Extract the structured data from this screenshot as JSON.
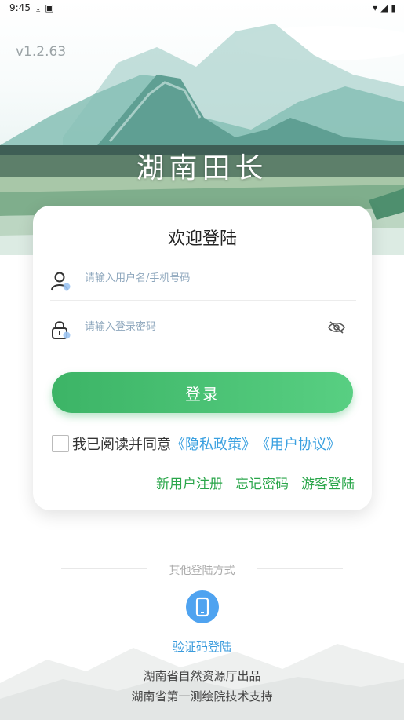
{
  "status": {
    "time": "9:45"
  },
  "version": "v1.2.63",
  "app_title": "湖南田长",
  "card": {
    "title": "欢迎登陆",
    "username_placeholder": "请输入用户名/手机号码",
    "password_placeholder": "请输入登录密码",
    "login_label": "登录",
    "agree_text": "我已阅读并同意",
    "privacy_link": "《隐私政策》",
    "agreement_link": "《用户协议》",
    "register": "新用户注册",
    "forgot": "忘记密码",
    "guest": "游客登陆"
  },
  "other": {
    "label": "其他登陆方式",
    "sms_label": "验证码登陆"
  },
  "footer": {
    "line1": "湖南省自然资源厅出品",
    "line2": "湖南省第一测绘院技术支持"
  },
  "colors": {
    "primary_green": "#3cb466",
    "link_blue": "#3aa0e0",
    "text_green": "#2aa64a"
  },
  "icons": {
    "user": "user-icon",
    "lock": "lock-icon",
    "eye": "eye-off-icon",
    "phone": "phone-icon"
  }
}
